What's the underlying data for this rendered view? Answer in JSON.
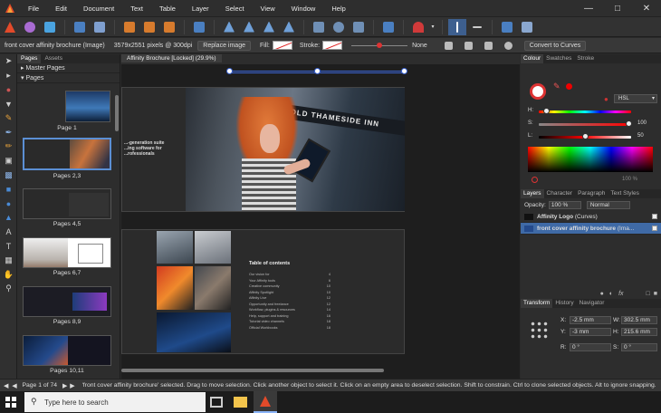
{
  "menubar": {
    "items": [
      "File",
      "Edit",
      "Document",
      "Text",
      "Table",
      "Layer",
      "Select",
      "View",
      "Window",
      "Help"
    ]
  },
  "contextbar": {
    "object_name": "front cover affinity brochure (Image)",
    "dimensions": "3579x2551 pixels @ 300dpi",
    "replace_image": "Replace image",
    "fill_label": "Fill:",
    "stroke_label": "Stroke:",
    "stroke_value": "None",
    "convert_to_curves": "Convert to Curves"
  },
  "pages_panel": {
    "tabs": [
      "Pages",
      "Assets"
    ],
    "master_pages": "Master Pages",
    "pages": "Pages",
    "thumbnails": [
      "Page 1",
      "Pages 2,3",
      "Pages 4,5",
      "Pages 6,7",
      "Pages 8,9",
      "Pages 10,11"
    ]
  },
  "canvas": {
    "doc_tab": "Affinity Brochure [Locked] (29.9%)",
    "spread1_text": [
      "...-generation suite",
      "...ing software for",
      "...rofessionals"
    ],
    "banner_text": "OLD THAMESIDE INN",
    "toc_title": "Table of contents",
    "toc_lines": [
      [
        "Our vision for",
        "4"
      ],
      [
        "Your Affinity tools",
        "6"
      ],
      [
        "Creative community",
        "10"
      ],
      [
        "Affinity Spotlight",
        "10"
      ],
      [
        "Affinity Live",
        "12"
      ],
      [
        "Opportunity and freelance",
        "12"
      ],
      [
        "Workflow, plugins & resources",
        "14"
      ],
      [
        "Help, support and training",
        "16"
      ],
      [
        "Tutorial video channels",
        "18"
      ],
      [
        "Official Workbooks",
        "18"
      ]
    ]
  },
  "colour_panel": {
    "tabs": [
      "Colour",
      "Swatches",
      "Stroke"
    ],
    "mode": "HSL",
    "h_label": "H:",
    "s_label": "S:",
    "s_value": "100",
    "l_label": "L:",
    "l_value": "50",
    "opacity_value": "100 %",
    "h_pos": 0.05,
    "s_pos": 1.0,
    "l_pos": 0.5
  },
  "layers_panel": {
    "tabs": [
      "Layers",
      "Character",
      "Paragraph",
      "Text Styles"
    ],
    "opacity_label": "Opacity:",
    "opacity_value": "100 %",
    "blend_mode": "Normal",
    "layers": [
      {
        "name": "Affinity Logo",
        "kind": "(Curves)"
      },
      {
        "name": "front cover affinity brochure",
        "kind": "(Ima..."
      }
    ]
  },
  "transform_panel": {
    "tabs": [
      "Transform",
      "History",
      "Navigator"
    ],
    "x_label": "X:",
    "x_value": "-2.5 mm",
    "y_label": "Y:",
    "y_value": "-3 mm",
    "w_label": "W:",
    "w_value": "302.5 mm",
    "h_label": "H:",
    "h_value": "215.6 mm",
    "r_label": "R:",
    "r_value": "0 °",
    "s_label": "S:",
    "s_value": "0 °"
  },
  "statusbar": {
    "page_indicator": "Page 1 of 74",
    "message": "'front cover affinity brochure' selected. Drag to move selection. Click another object to select it. Click on an empty area to deselect selection. Shift to constrain. Ctrl to clone selected objects. Alt to ignore snapping."
  },
  "taskbar": {
    "search_placeholder": "Type here to search"
  },
  "colors": {
    "accent": "#3f6aa6",
    "app_bg": "#2d2d2d",
    "canvas_bg": "#1e1e1e"
  }
}
